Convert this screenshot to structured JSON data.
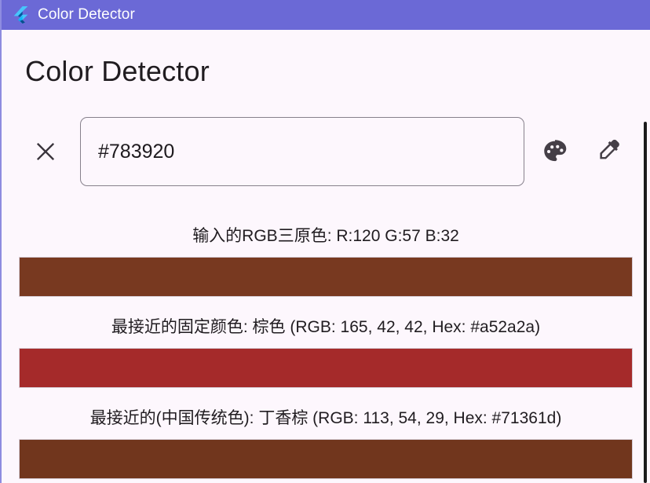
{
  "window": {
    "title": "Color Detector",
    "logo_icon": "flutter-logo-icon",
    "titlebar_color": "#6b69d6",
    "background_color": "#fdf7fd"
  },
  "page": {
    "heading": "Color Detector"
  },
  "input_row": {
    "clear_icon": "close-x-icon",
    "hex_value": "#783920",
    "hex_placeholder": "#783920",
    "palette_icon": "palette-icon",
    "eyedropper_icon": "eyedropper-icon"
  },
  "results": {
    "input_rgb_label": "输入的RGB三原色: R:120 G:57 B:32",
    "input_swatch_color": "#783920",
    "fixed_color_label": "最接近的固定颜色: 棕色 (RGB: 165, 42, 42, Hex: #a52a2a)",
    "fixed_swatch_color": "#a52a2a",
    "china_color_label": "最接近的(中国传统色): 丁香棕 (RGB: 113, 54, 29, Hex: #71361d)",
    "china_swatch_color": "#71361d"
  },
  "scrollbar": {
    "thumb_color": "#1b1b1b"
  }
}
